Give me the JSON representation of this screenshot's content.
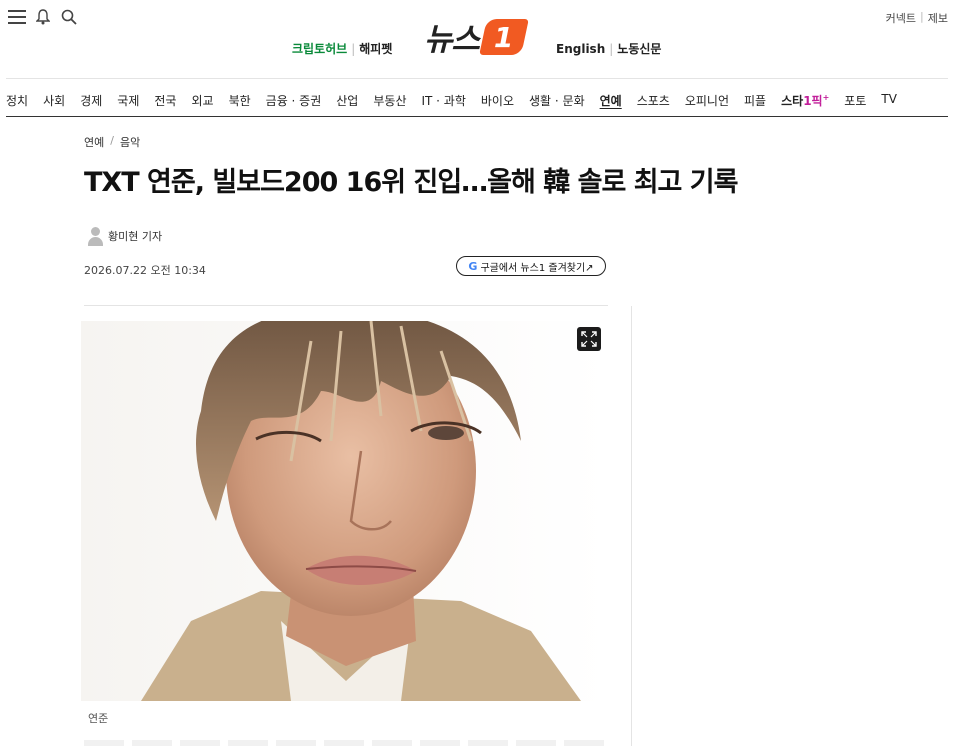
{
  "header": {
    "icons": [
      "menu-icon",
      "bell-icon",
      "search-icon"
    ],
    "util_links": [
      "커넥트",
      "제보"
    ],
    "service_links": [
      "크립토허브",
      "해피펫"
    ],
    "logo_text": "뉴스",
    "logo_badge": "1",
    "lang_links": [
      "English",
      "노동신문"
    ],
    "brand_color": "#f15a22",
    "green_color": "#0a8a3a"
  },
  "nav": {
    "items": [
      "정치",
      "사회",
      "경제",
      "국제",
      "전국",
      "외교",
      "북한",
      "금융 · 증권",
      "산업",
      "부동산",
      "IT · 과학",
      "바이오",
      "생활 · 문화",
      "연예",
      "스포츠",
      "오피니언",
      "피플"
    ],
    "active": "연예",
    "star_prefix": "스타",
    "star_suffix": "1픽",
    "star_sup": "+",
    "tail_items": [
      "포토",
      "TV"
    ],
    "star_color": "#c21e9a"
  },
  "article": {
    "breadcrumb": [
      "연예",
      "음악"
    ],
    "headline": "TXT 연준, 빌보드200 16위 진입…올해 韓 솔로 최고 기록",
    "author": "황미현 기자",
    "datetime": "2026.07.22 오전 10:34",
    "google_button": "구글에서 뉴스1 즐겨찾기↗",
    "google_mark": "G",
    "photo_caption": "연준"
  }
}
